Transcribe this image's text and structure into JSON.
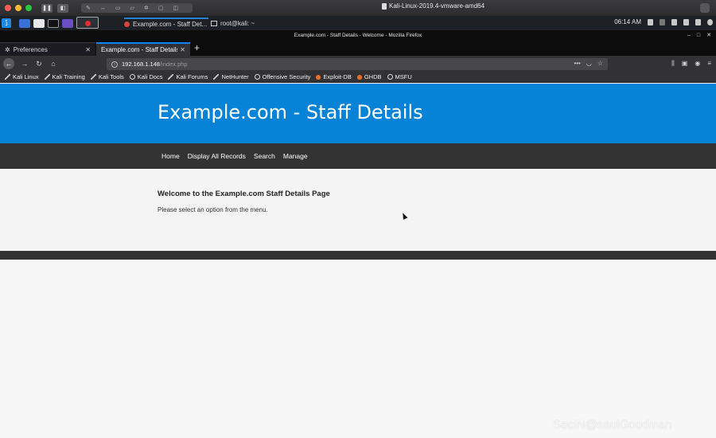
{
  "mac": {
    "title": "Kali-Linux-2019.4-vmware-amd64"
  },
  "kali_panel": {
    "taskbar": [
      {
        "label": "Example.com - Staff Det..."
      },
      {
        "label": "root@kali: ~"
      }
    ],
    "clock": "06:14 AM"
  },
  "firefox": {
    "window_title": "Example.com - Staff Details - Welcome - Mozilla Firefox",
    "tabs": [
      {
        "label": "Preferences"
      },
      {
        "label": "Example.com - Staff Details"
      }
    ],
    "url": {
      "host": "192.168.1.148",
      "path": "/index.php"
    },
    "bookmarks": [
      "Kali Linux",
      "Kali Training",
      "Kali Tools",
      "Kali Docs",
      "Kali Forums",
      "NetHunter",
      "Offensive Security",
      "Exploit-DB",
      "GHDB",
      "MSFU"
    ]
  },
  "site": {
    "heading": "Example.com - Staff Details",
    "menu": [
      "Home",
      "Display All Records",
      "Search",
      "Manage"
    ],
    "welcome_title": "Welcome to the Example.com Staff Details Page",
    "welcome_text": "Please select an option from the menu."
  },
  "watermark": "SecIN@saulGoodman"
}
